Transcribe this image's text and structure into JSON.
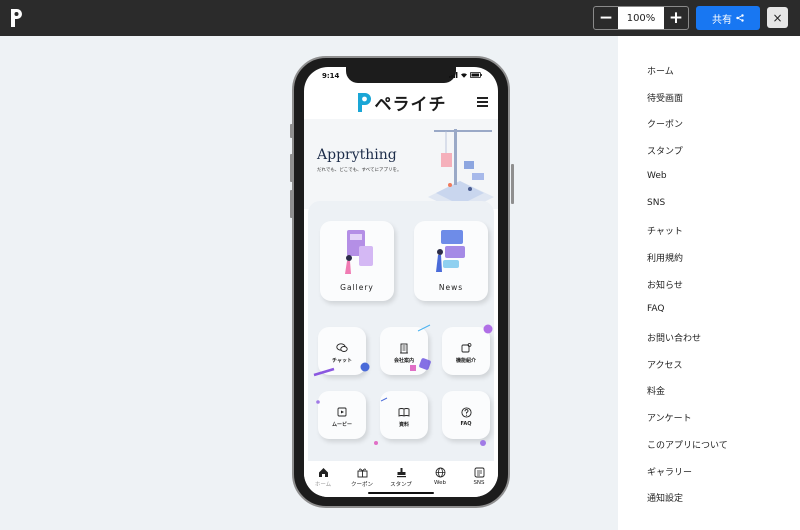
{
  "toolbar": {
    "zoom_out": "−",
    "zoom_value": "100%",
    "zoom_in": "+",
    "share_label": "共有",
    "close_label": "×"
  },
  "side_menu": [
    "ホーム",
    "待受画面",
    "クーポン",
    "スタンプ",
    "Web",
    "SNS",
    "チャット",
    "利用規約",
    "お知らせ",
    "FAQ",
    "お問い合わせ",
    "アクセス",
    "料金",
    "アンケート",
    "このアプリについて",
    "ギャラリー",
    "通知設定"
  ],
  "phone": {
    "time": "9:14",
    "brand": "ペライチ",
    "hero_title": "Apprything",
    "hero_subtitle": "だれでも、どこでも、すべてにアプリを。",
    "big_tiles": [
      "Gallery",
      "News"
    ],
    "small_tiles": [
      "チャット",
      "会社案内",
      "機能紹介",
      "ムービー",
      "資料",
      "FAQ"
    ],
    "nav": [
      "ホーム",
      "クーポン",
      "スタンプ",
      "Web",
      "SNS"
    ]
  },
  "colors": {
    "accent": "#1877f2",
    "brand": "#1aa6d6",
    "topbar": "#2b2b2b"
  }
}
